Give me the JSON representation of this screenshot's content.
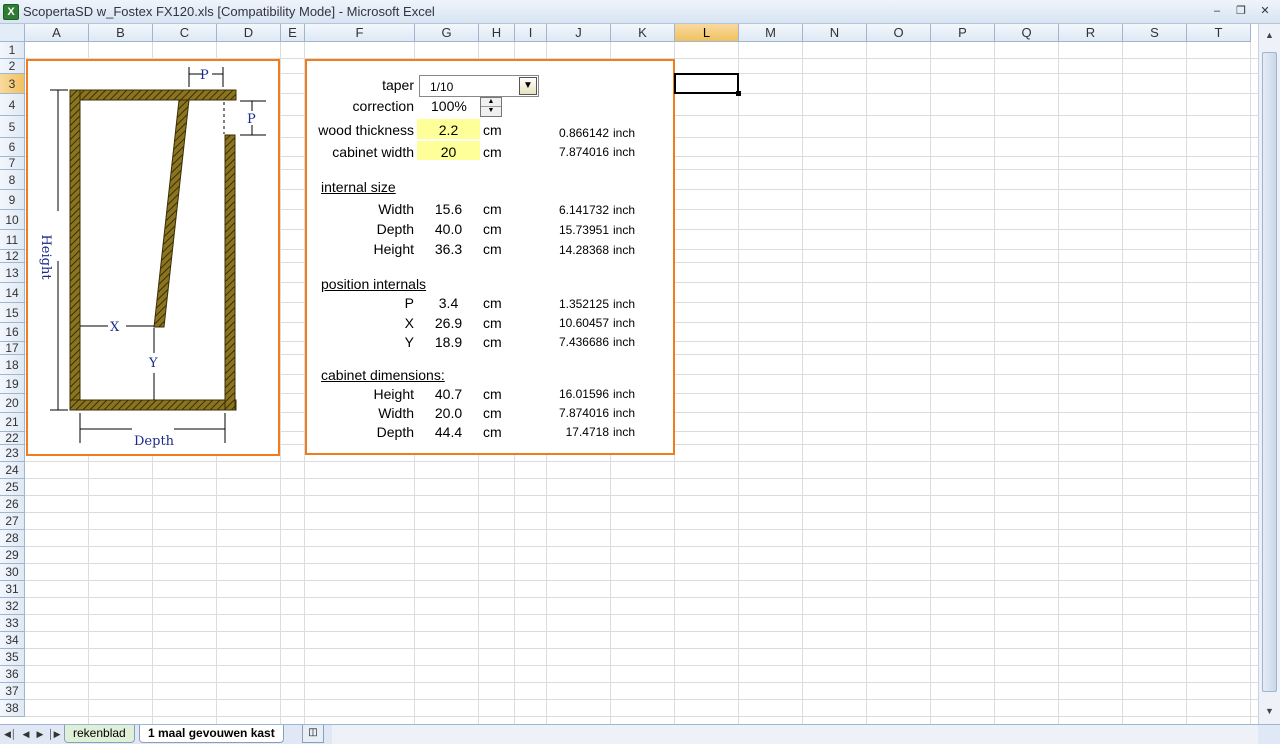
{
  "window": {
    "title": "ScopertaSD w_Fostex FX120.xls  [Compatibility Mode] - Microsoft Excel",
    "icon": "excel-icon",
    "minimize": "–",
    "restore": "❐",
    "close": "✕"
  },
  "columns": [
    "A",
    "B",
    "C",
    "D",
    "E",
    "F",
    "G",
    "H",
    "I",
    "J",
    "K",
    "L",
    "M",
    "N",
    "O",
    "P",
    "Q",
    "R",
    "S",
    "T"
  ],
  "rows": [
    "1",
    "2",
    "3",
    "4",
    "5",
    "6",
    "7",
    "8",
    "9",
    "10",
    "11",
    "12",
    "13",
    "14",
    "15",
    "16",
    "17",
    "18",
    "19",
    "20",
    "21",
    "22",
    "23",
    "24",
    "25",
    "26",
    "27",
    "28",
    "29",
    "30",
    "31",
    "32",
    "33",
    "34",
    "35",
    "36",
    "37",
    "38"
  ],
  "diagram": {
    "label_p_top": "P",
    "label_p_right": "P",
    "label_height": "Height",
    "label_x": "X",
    "label_y": "Y",
    "label_depth": "Depth",
    "wood_color": "#8b7420"
  },
  "form": {
    "taper_label": "taper",
    "taper_value": "1/10",
    "correction_label": "correction",
    "correction_value": "100%",
    "wood_thickness_label": "wood thickness",
    "wood_thickness_value": "2.2",
    "wood_thickness_unit": "cm",
    "wood_thickness_inch": "0.866142",
    "cabinet_width_label": "cabinet width",
    "cabinet_width_value": "20",
    "cabinet_width_unit": "cm",
    "cabinet_width_inch": "7.874016",
    "inch_unit": "inch"
  },
  "sections": [
    {
      "title": "internal size",
      "rows": [
        {
          "label": "Width",
          "value": "15.6",
          "unit": "cm",
          "inch": "6.141732",
          "inch_unit": "inch"
        },
        {
          "label": "Depth",
          "value": "40.0",
          "unit": "cm",
          "inch": "15.73951",
          "inch_unit": "inch"
        },
        {
          "label": "Height",
          "value": "36.3",
          "unit": "cm",
          "inch": "14.28368",
          "inch_unit": "inch"
        }
      ]
    },
    {
      "title": "position internals",
      "rows": [
        {
          "label": "P",
          "value": "3.4",
          "unit": "cm",
          "inch": "1.352125",
          "inch_unit": "inch"
        },
        {
          "label": "X",
          "value": "26.9",
          "unit": "cm",
          "inch": "10.60457",
          "inch_unit": "inch"
        },
        {
          "label": "Y",
          "value": "18.9",
          "unit": "cm",
          "inch": "7.436686",
          "inch_unit": "inch"
        }
      ]
    },
    {
      "title": "cabinet dimensions:",
      "rows": [
        {
          "label": "Height",
          "value": "40.7",
          "unit": "cm",
          "inch": "16.01596",
          "inch_unit": "inch"
        },
        {
          "label": "Width",
          "value": "20.0",
          "unit": "cm",
          "inch": "7.874016",
          "inch_unit": "inch"
        },
        {
          "label": "Depth",
          "value": "44.4",
          "unit": "cm",
          "inch": "17.4718",
          "inch_unit": "inch"
        }
      ]
    }
  ],
  "selected_cell": "L3",
  "colors": {
    "frame_border": "#f07c1e",
    "input_fill": "#ffff99",
    "selected_header": "#f1c15f"
  },
  "sheet_tabs": [
    {
      "label": "rekenblad",
      "active": false
    },
    {
      "label": "1 maal gevouwen kast",
      "active": true
    }
  ]
}
